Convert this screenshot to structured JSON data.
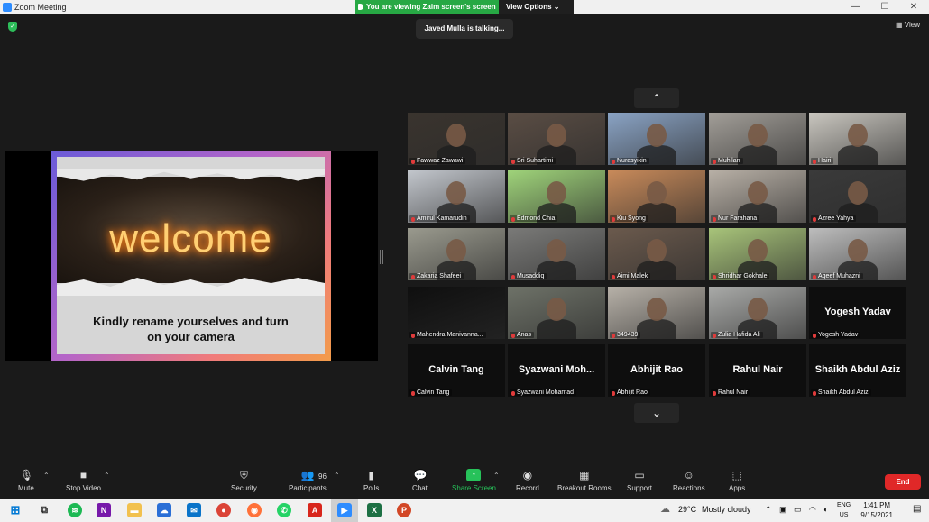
{
  "window": {
    "title": "Zoom Meeting",
    "controls": [
      "—",
      "□",
      "☐",
      "✕"
    ]
  },
  "share_banner": {
    "status": "You are viewing Zaim screen's screen",
    "view_options": "View Options ⌄"
  },
  "header": {
    "view_label": "View",
    "talking": "Javed Mulla is talking..."
  },
  "slide": {
    "headline": "welcome",
    "line1": "Kindly rename yourselves and turn",
    "line2": "on your camera"
  },
  "gallery": {
    "nav_up": "⌃",
    "nav_down": "⌄",
    "tiles": [
      {
        "name": "Fawwaz Zawawi",
        "video": true,
        "bg": "#3a342e"
      },
      {
        "name": "Sri Suhartimi",
        "video": true,
        "bg": "#5a4d44"
      },
      {
        "name": "Nurasyikin",
        "video": true,
        "bg": "#8aa3c4"
      },
      {
        "name": "Muhilan",
        "video": true,
        "bg": "#a29e98"
      },
      {
        "name": "Hairi",
        "video": true,
        "bg": "#c9c6bf"
      },
      {
        "name": "Amirul Kamarudin",
        "video": true,
        "bg": "#c2c6cc"
      },
      {
        "name": "Edmond Chia",
        "video": true,
        "bg": "#9fd37a"
      },
      {
        "name": "Kiu Syong",
        "video": true,
        "bg": "#c88a5a"
      },
      {
        "name": "Nur Farahana",
        "video": true,
        "bg": "#b8b0a6"
      },
      {
        "name": "Azree Yahya",
        "video": true,
        "bg": "#3a3a3a"
      },
      {
        "name": "Zakaria Shafeei",
        "video": true,
        "bg": "#9a9a8e"
      },
      {
        "name": "Musaddiq",
        "video": true,
        "bg": "#7a7a78"
      },
      {
        "name": "Aimi Malek",
        "video": true,
        "bg": "#6b5a4d"
      },
      {
        "name": "Shridhar Gokhale",
        "video": true,
        "bg": "#a8c47a"
      },
      {
        "name": "Aqeef Muhazni",
        "video": true,
        "bg": "#bdbdbd"
      },
      {
        "name": "Mahendra Manivanna...",
        "video": true,
        "bg": "#0f0f0f"
      },
      {
        "name": "Anas",
        "video": true,
        "bg": "#6e7268"
      },
      {
        "name": "349439",
        "video": true,
        "bg": "#b7b1a8"
      },
      {
        "name": "Zulia Hafida Ali",
        "video": true,
        "bg": "#a9aaa8"
      },
      {
        "name": "Yogesh Yadav",
        "video": false,
        "big": "Yogesh Yadav"
      },
      {
        "name": "Calvin Tang",
        "video": false,
        "big": "Calvin Tang"
      },
      {
        "name": "Syazwani Mohamad",
        "video": false,
        "big": "Syazwani  Moh..."
      },
      {
        "name": "Abhijit Rao",
        "video": false,
        "big": "Abhijit Rao"
      },
      {
        "name": "Rahul Nair",
        "video": false,
        "big": "Rahul Nair"
      },
      {
        "name": "Shaikh Abdul Aziz",
        "video": false,
        "big": "Shaikh Abdul Aziz"
      }
    ]
  },
  "toolbar": {
    "mute": "Mute",
    "stop_video": "Stop Video",
    "security": "Security",
    "participants": "Participants",
    "participants_count": "96",
    "polls": "Polls",
    "chat": "Chat",
    "share_screen": "Share Screen",
    "record": "Record",
    "breakout_rooms": "Breakout Rooms",
    "support": "Support",
    "reactions": "Reactions",
    "apps": "Apps",
    "end": "End"
  },
  "taskbar": {
    "weather": "29°C",
    "weather_desc": "Mostly cloudy",
    "lang1": "ENG",
    "lang2": "US",
    "time": "1:41 PM",
    "date": "9/15/2021"
  },
  "colors": {
    "accent_green": "#27a844",
    "end_red": "#e02828",
    "brand_blue": "#2d8cff"
  }
}
